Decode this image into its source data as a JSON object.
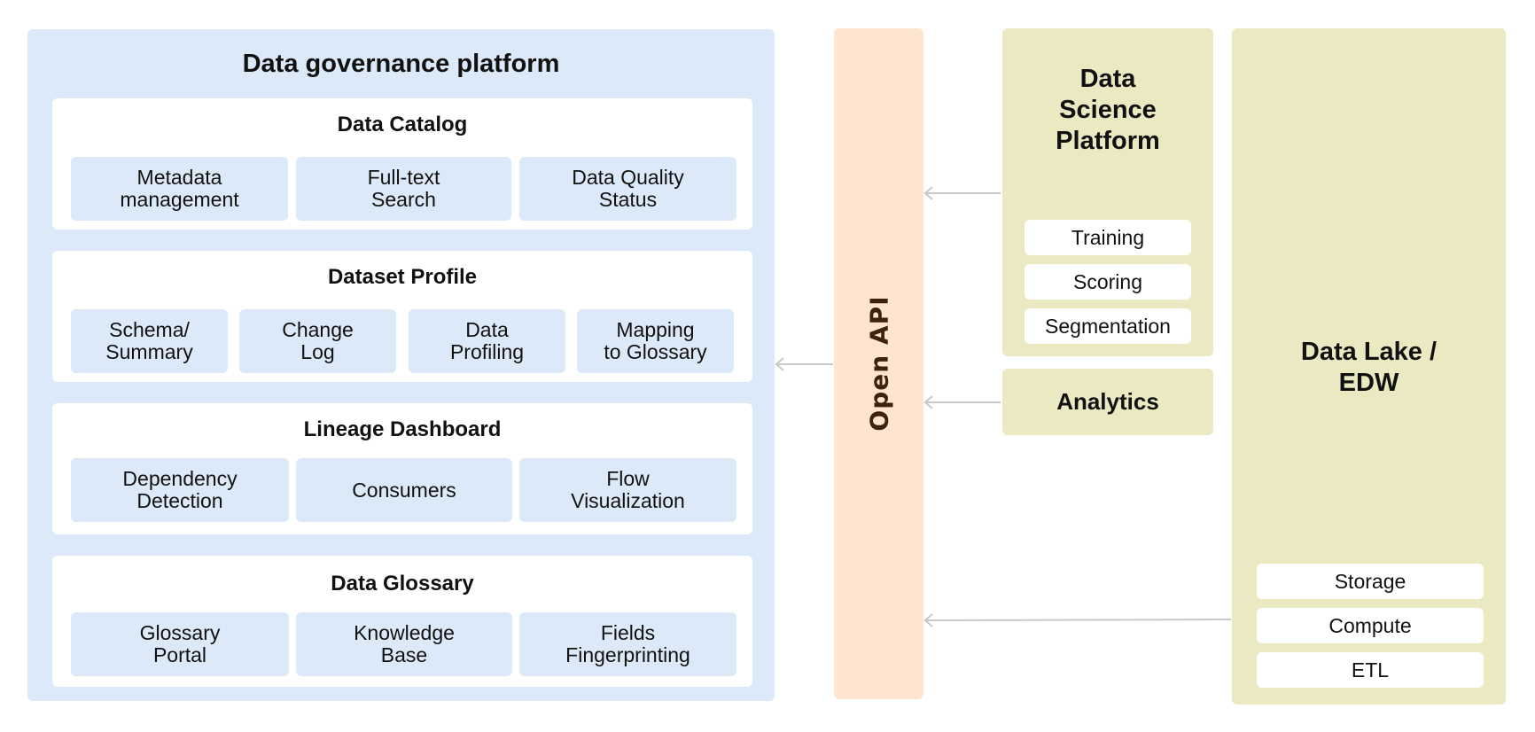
{
  "colors": {
    "governance_bg": "#dce9f8",
    "section_bg": "#ffffff",
    "chip_bg": "#dce9f8",
    "open_api_bg": "#fde5cf",
    "open_api_text": "#3b230f",
    "source_bg": "#ebe9c1",
    "arrow": "#c8c8c8"
  },
  "governance": {
    "title": "Data governance platform",
    "sections": [
      {
        "title": "Data Catalog",
        "items": [
          "Metadata\nmanagement",
          "Full-text\nSearch",
          "Data Quality\nStatus"
        ]
      },
      {
        "title": "Dataset Profile",
        "items": [
          "Schema/\nSummary",
          "Change\nLog",
          "Data\nProfiling",
          "Mapping\nto Glossary"
        ]
      },
      {
        "title": "Lineage Dashboard",
        "items": [
          "Dependency\nDetection",
          "Consumers",
          "Flow\nVisualization"
        ]
      },
      {
        "title": "Data Glossary",
        "items": [
          "Glossary\nPortal",
          "Knowledge\nBase",
          "Fields\nFingerprinting"
        ]
      }
    ]
  },
  "open_api": {
    "label": "Open API"
  },
  "data_science": {
    "title": "Data\nScience\nPlatform",
    "items": [
      "Training",
      "Scoring",
      "Segmentation"
    ]
  },
  "analytics": {
    "title": "Analytics"
  },
  "data_lake": {
    "title": "Data Lake /\nEDW",
    "items": [
      "Storage",
      "Compute",
      "ETL"
    ]
  },
  "connections": [
    {
      "from": "Data Science Platform",
      "to": "Open API"
    },
    {
      "from": "Analytics",
      "to": "Open API"
    },
    {
      "from": "Data Lake / EDW",
      "to": "Open API"
    },
    {
      "from": "Open API",
      "to": "Data governance platform"
    }
  ]
}
